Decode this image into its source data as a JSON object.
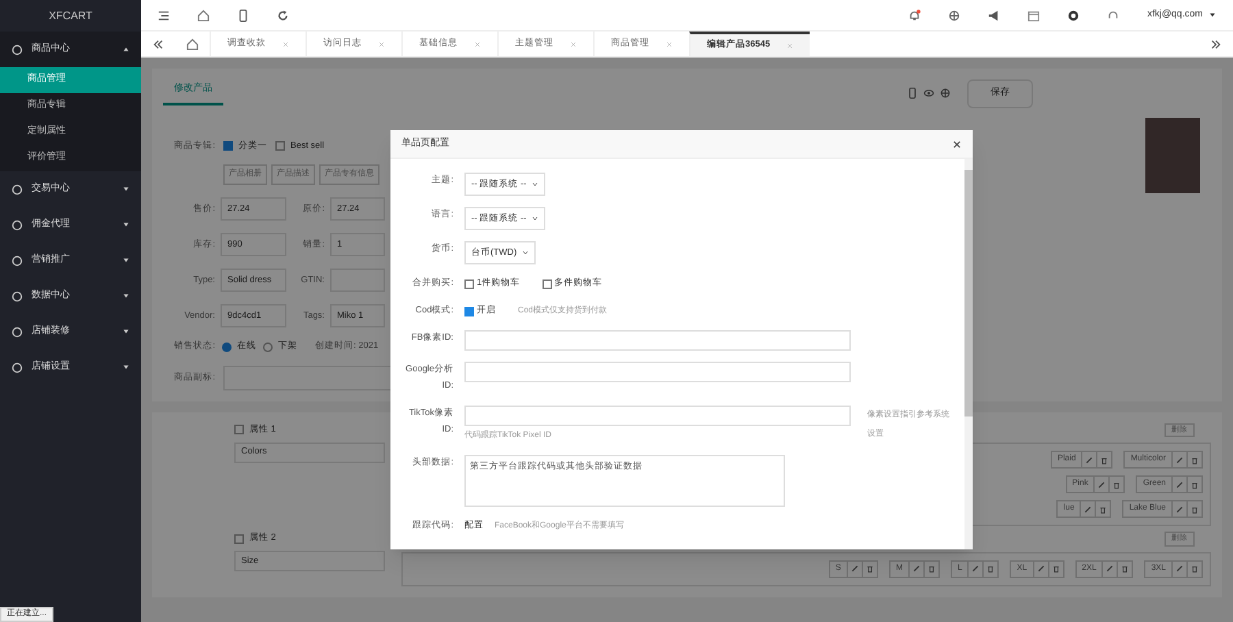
{
  "brand": "XFCART",
  "sidebar": {
    "items": [
      {
        "label": "商品中心",
        "expanded": true,
        "children": [
          {
            "label": "商品管理",
            "selected": true
          },
          {
            "label": "商品专辑",
            "selected": false
          },
          {
            "label": "定制属性",
            "selected": false
          },
          {
            "label": "评价管理",
            "selected": false
          }
        ]
      },
      {
        "label": "交易中心",
        "expanded": false
      },
      {
        "label": "佣金代理",
        "expanded": false
      },
      {
        "label": "营销推广",
        "expanded": false
      },
      {
        "label": "数据中心",
        "expanded": false
      },
      {
        "label": "店铺装修",
        "expanded": false
      },
      {
        "label": "店铺设置",
        "expanded": false
      }
    ]
  },
  "user": "xfkj@qq.com",
  "tabs": [
    {
      "label": "调查收款",
      "selected": false
    },
    {
      "label": "访问日志",
      "selected": false
    },
    {
      "label": "基础信息",
      "selected": false
    },
    {
      "label": "主题管理",
      "selected": false
    },
    {
      "label": "商品管理",
      "selected": false
    },
    {
      "label": "编辑产品36545",
      "selected": true
    }
  ],
  "page": {
    "tab": "修改产品",
    "save": "保存",
    "album": {
      "label": "商品专辑:",
      "options": [
        {
          "label": "分类一",
          "checked": true
        },
        {
          "label": "Best sell",
          "checked": false
        }
      ]
    },
    "buttons": [
      "产品相册",
      "产品描述",
      "产品专有信息"
    ],
    "rows": [
      [
        {
          "label": "售价:",
          "value": "27.24"
        },
        {
          "label": "原价:",
          "value": "27.24"
        }
      ],
      [
        {
          "label": "库存:",
          "value": "990"
        },
        {
          "label": "销量:",
          "value": "1"
        }
      ],
      [
        {
          "label": "Type:",
          "value": "Solid dress"
        },
        {
          "label": "GTIN:"
        }
      ],
      [
        {
          "label": "Vendor:",
          "value": "9dc4cd1"
        },
        {
          "label": "Tags:",
          "value": "Miko 1"
        }
      ]
    ],
    "status": {
      "label": "销售状态:",
      "options": [
        {
          "label": "在线",
          "selected": true
        },
        {
          "label": "下架",
          "selected": false
        }
      ],
      "created": "创建时间: 2021"
    },
    "subtitle": {
      "label": "商品副标:"
    },
    "attributes": [
      {
        "label": "属性 1",
        "checked": false,
        "value": "Colors",
        "add": "删除",
        "chips": [
          [
            "Plaid",
            "Multicolor"
          ],
          [
            "Pink",
            "Green"
          ],
          [
            "lue",
            "Lake Blue"
          ]
        ]
      },
      {
        "label": "属性 2",
        "checked": false,
        "value": "Size",
        "add": "删除",
        "chips": [
          [
            "S",
            "M",
            "L",
            "XL",
            "2XL",
            "3XL"
          ]
        ]
      }
    ]
  },
  "modal": {
    "title": "单品页配置",
    "fields": [
      {
        "kind": "select",
        "label": "主题:",
        "value": "-- 跟随系统 --"
      },
      {
        "kind": "select",
        "label": "语言:",
        "value": "-- 跟随系统 --"
      },
      {
        "kind": "select",
        "label": "货币:",
        "value": "台币(TWD)"
      },
      {
        "kind": "checks",
        "label": "合并购买:",
        "options": [
          {
            "label": "1件购物车",
            "checked": false
          },
          {
            "label": "多件购物车",
            "checked": false
          }
        ]
      },
      {
        "kind": "checks",
        "label": "Cod模式:",
        "options": [
          {
            "label": "开启",
            "checked": true
          }
        ],
        "note": "Cod模式仅支持货到付款"
      },
      {
        "kind": "input",
        "label": "FB像素ID:"
      },
      {
        "kind": "input",
        "label": "Google分析ID:"
      },
      {
        "kind": "input",
        "label": "TikTok像素ID:",
        "help": "代码跟踪TikTok Pixel ID",
        "side": "像素设置指引参考系统设置"
      },
      {
        "kind": "textarea",
        "label": "头部数据:",
        "value": "第三方平台跟踪代码或其他头部验证数据"
      },
      {
        "kind": "link",
        "label": "跟踪代码:",
        "link": "配置",
        "note": "FaceBook和Google平台不需要填写"
      }
    ]
  },
  "statusbar": "正在建立..."
}
